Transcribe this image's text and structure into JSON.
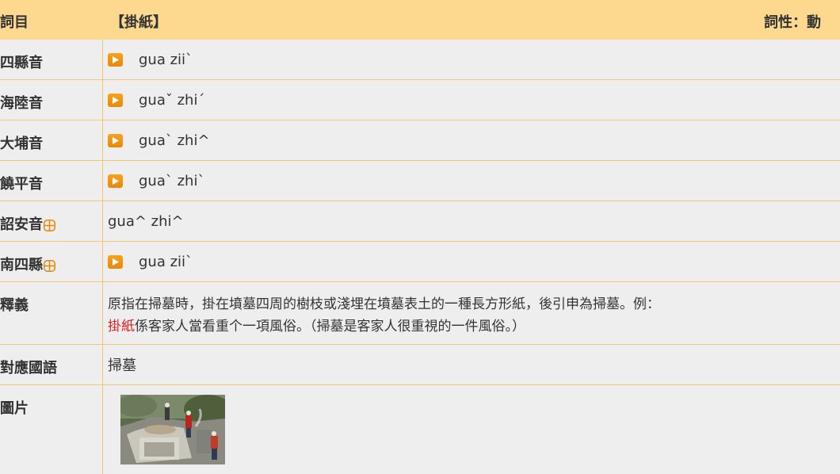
{
  "header": {
    "label": "詞目",
    "term": "【掛紙】",
    "part_of_speech": "詞性：動"
  },
  "pronunciations": [
    {
      "dialect": "四縣音",
      "text": "gua zii`",
      "has_audio": true,
      "has_plus": false
    },
    {
      "dialect": "海陸音",
      "text": "guaˇ zhi´",
      "has_audio": true,
      "has_plus": false
    },
    {
      "dialect": "大埔音",
      "text": "gua` zhi^",
      "has_audio": true,
      "has_plus": false
    },
    {
      "dialect": "饒平音",
      "text": "gua` zhi`",
      "has_audio": true,
      "has_plus": false
    },
    {
      "dialect": "詔安音",
      "text": "gua^ zhi^",
      "has_audio": false,
      "has_plus": true
    },
    {
      "dialect": "南四縣",
      "text": "gua zii`",
      "has_audio": true,
      "has_plus": true
    }
  ],
  "definition": {
    "label": "釋義",
    "line1": "原指在掃墓時，掛在墳墓四周的樹枝或淺埋在墳墓表土的一種長方形紙，後引申為掃墓。例：",
    "example_highlight": "掛紙",
    "example_rest": "係客家人當看重个一項風俗。（掃墓是客家人很重視的一件風俗。）"
  },
  "mandarin": {
    "label": "對應國語",
    "value": "掃墓"
  },
  "picture": {
    "label": "圖片"
  },
  "colors": {
    "header_bg": "#fcd98f",
    "border": "#f6c66e",
    "body_bg": "#eeeeee",
    "audio_button": "#f39a14",
    "highlight": "#dd2222"
  }
}
